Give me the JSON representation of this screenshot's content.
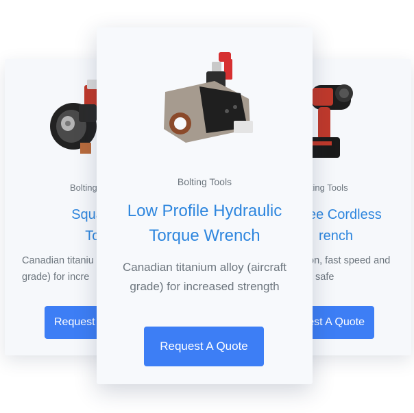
{
  "cards": [
    {
      "category": "Bolting",
      "title": "Square Drive Torque W",
      "title_lines": [
        "Square Driv",
        "Torque W"
      ],
      "description_lines": [
        "Canadian titaniu",
        "grade) for incre"
      ],
      "button_label": "Request"
    },
    {
      "category": "Bolting Tools",
      "title_lines": [
        "Low Profile Hydraulic",
        "Torque Wrench"
      ],
      "description_lines": [
        "Canadian titanium alloy (aircraft",
        "grade) for increased strength"
      ],
      "button_label": "Request A Quote"
    },
    {
      "category": "lting Tools",
      "title_lines": [
        "ee Cordless",
        "rench"
      ],
      "description_lines": [
        "on, fast speed and",
        "safe"
      ],
      "button_label": "est A Quote"
    }
  ],
  "colors": {
    "title": "#2e86de",
    "button": "#3d7ef5",
    "card_bg": "#f6f8fb",
    "muted_text": "#6c757d"
  },
  "icons": {
    "left": "square-drive-wrench-image",
    "center": "hydraulic-wrench-image",
    "right": "cordless-wrench-image"
  }
}
